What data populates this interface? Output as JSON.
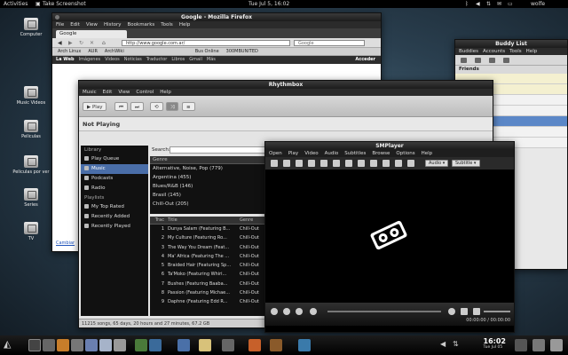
{
  "topbar": {
    "activities": "Activities",
    "task": "Take Screenshot",
    "clock": "Tue Jul 5, 16:02",
    "user": "wolfe"
  },
  "desktop": {
    "icons": [
      "Computer",
      "Music Videos",
      "Peliculas",
      "Peliculas por ver",
      "Series",
      "TV"
    ]
  },
  "firefox": {
    "title": "Google - Mozilla Firefox",
    "menu": [
      "File",
      "Edit",
      "View",
      "History",
      "Bookmarks",
      "Tools",
      "Help"
    ],
    "tab": "Google",
    "url": "http://www.google.com.ar/",
    "search_placeholder": "Google",
    "bookmarks": [
      "Arch Linux",
      "AUR",
      "ArchWiki",
      "Bus Online",
      "300MBUNITED"
    ],
    "google_bar": [
      "La Web",
      "Imágenes",
      "Videos",
      "Noticias",
      "Traductor",
      "Libros",
      "Gmail",
      "Más"
    ],
    "google_login": "Acceder",
    "left_link": "Cambiar"
  },
  "rhythmbox": {
    "title": "Rhythmbox",
    "menu": [
      "Music",
      "Edit",
      "View",
      "Control",
      "Help"
    ],
    "play_label": "Play",
    "now_playing": "Not Playing",
    "library_header": "Library",
    "library_items": [
      "Play Queue",
      "Music",
      "Podcasts",
      "Radio"
    ],
    "playlists_header": "Playlists",
    "playlist_items": [
      "My Top Rated",
      "Recently Added",
      "Recently Played"
    ],
    "search_label": "Search:",
    "genre_header": "Genre",
    "genres": [
      "Alternative, Noise, Pop (779)",
      "Argentina (455)",
      "Blues/R&B (146)",
      "Brasil (145)",
      "Chill-Out (205)"
    ],
    "song_columns": [
      "Trac",
      "Title",
      "Genre"
    ],
    "songs": [
      {
        "n": "1",
        "title": "Dunya Salam (Featuring B...",
        "genre": "Chill-Out"
      },
      {
        "n": "2",
        "title": "My Culture (Featuring Ro...",
        "genre": "Chill-Out"
      },
      {
        "n": "3",
        "title": "The Way You Dream (Feat...",
        "genre": "Chill-Out"
      },
      {
        "n": "4",
        "title": "Ma' Africa (Featuring The ...",
        "genre": "Chill-Out"
      },
      {
        "n": "5",
        "title": "Braided Hair (Featuring Sp...",
        "genre": "Chill-Out"
      },
      {
        "n": "6",
        "title": "Ta'Moko (Featuring Whiri...",
        "genre": "Chill-Out"
      },
      {
        "n": "7",
        "title": "Bushes (Featuring Baaba...",
        "genre": "Chill-Out"
      },
      {
        "n": "8",
        "title": "Passion (Featuring Michae...",
        "genre": "Chill-Out"
      },
      {
        "n": "9",
        "title": "Daphne (Featuring Edd R...",
        "genre": "Chill-Out"
      }
    ],
    "status": "11215 songs, 65 days, 20 hours and 27 minutes, 67.2 GB"
  },
  "smplayer": {
    "title": "SMPlayer",
    "menu": [
      "Open",
      "Play",
      "Video",
      "Audio",
      "Subtitles",
      "Browse",
      "Options",
      "Help"
    ],
    "audio_label": "Audio",
    "subtitle_label": "Subtitle",
    "time": "00:00:00 / 00:00:00"
  },
  "buddy": {
    "title": "Buddy List",
    "menu": [
      "Buddies",
      "Accounts",
      "Tools",
      "Help"
    ],
    "group": "Friends"
  },
  "taskbar": {
    "time": "16:02",
    "date": "Tue Jul 05"
  }
}
